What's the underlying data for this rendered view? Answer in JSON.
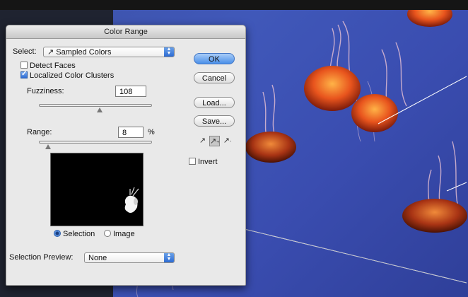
{
  "dialog": {
    "title": "Color Range",
    "select_label": "Select:",
    "select_value": "Sampled Colors",
    "select_icon": "eyedropper-icon",
    "detect_faces": {
      "label": "Detect Faces",
      "checked": false
    },
    "localized_clusters": {
      "label": "Localized Color Clusters",
      "checked": true
    },
    "fuzziness": {
      "label": "Fuzziness:",
      "value": "108",
      "slider_fraction": 0.54
    },
    "range": {
      "label": "Range:",
      "value": "8",
      "unit": "%",
      "slider_fraction": 0.08
    },
    "preview_mode": {
      "selection_label": "Selection",
      "image_label": "Image",
      "selected": "Selection"
    },
    "selection_preview": {
      "label": "Selection Preview:",
      "value": "None"
    },
    "buttons": {
      "ok": "OK",
      "cancel": "Cancel",
      "load": "Load...",
      "save": "Save..."
    },
    "invert": {
      "label": "Invert",
      "checked": false
    },
    "eyedroppers": [
      "eyedropper-icon",
      "eyedropper-plus-icon",
      "eyedropper-minus-icon"
    ]
  },
  "colors": {
    "background_blue": "#3f55b3",
    "jelly_orange": "#e8541d",
    "button_accent": "#4a8fe8"
  }
}
